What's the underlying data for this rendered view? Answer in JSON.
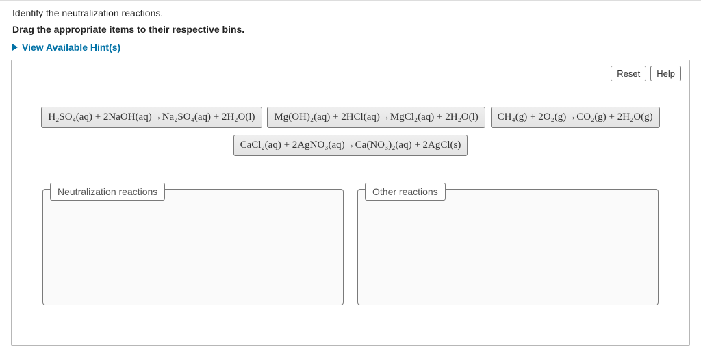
{
  "intro": "Identify the neutralization reactions.",
  "instruction": "Drag the appropriate items to their respective bins.",
  "hints_label": "View Available Hint(s)",
  "buttons": {
    "reset": "Reset",
    "help": "Help"
  },
  "tiles": {
    "r1": "H₂SO₄(aq) + 2NaOH(aq)→Na₂SO₄(aq) + 2H₂O(l)",
    "r2": "Mg(OH)₂(aq) + 2HCl(aq)→MgCl₂(aq) + 2H₂O(l)",
    "r3": "CH₄(g) + 2O₂(g)→CO₂(g) + 2H₂O(g)",
    "r4": "CaCl₂(aq) + 2AgNO₃(aq)→Ca(NO₃)₂(aq) + 2AgCl(s)"
  },
  "bins": {
    "left": "Neutralization reactions",
    "right": "Other reactions"
  }
}
